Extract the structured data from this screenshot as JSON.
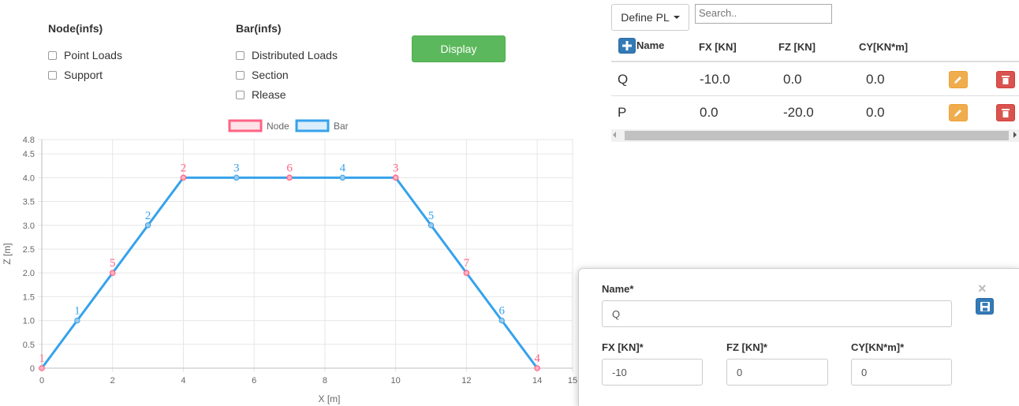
{
  "filters": {
    "node": {
      "title": "Node(infs)",
      "options": [
        {
          "label": "Point Loads",
          "checked": false
        },
        {
          "label": "Support",
          "checked": false
        }
      ]
    },
    "bar": {
      "title": "Bar(infs)",
      "options": [
        {
          "label": "Distributed Loads",
          "checked": false
        },
        {
          "label": "Section",
          "checked": false
        },
        {
          "label": "Rlease",
          "checked": false
        }
      ]
    },
    "display_label": "Display"
  },
  "chart_data": {
    "type": "line",
    "legend": [
      {
        "name": "Node",
        "color": "#ff6384"
      },
      {
        "name": "Bar",
        "color": "#36a2eb"
      }
    ],
    "xlabel": "X [m]",
    "ylabel": "Z [m]",
    "xlim": [
      0,
      15
    ],
    "ylim": [
      0,
      4.8
    ],
    "x_ticks": [
      "0",
      "2",
      "4",
      "6",
      "8",
      "10",
      "12",
      "14",
      "15"
    ],
    "y_ticks": [
      "0",
      "0.5",
      "1.0",
      "1.5",
      "2.0",
      "2.5",
      "3.0",
      "3.5",
      "4.0",
      "4.5",
      "4.8"
    ],
    "grid": true,
    "structure": [
      {
        "x": 0,
        "y": 0
      },
      {
        "x": 4,
        "y": 4
      },
      {
        "x": 10,
        "y": 4
      },
      {
        "x": 14,
        "y": 0
      }
    ],
    "nodes": [
      {
        "label": "1",
        "x": 0,
        "y": 0
      },
      {
        "label": "5",
        "x": 2,
        "y": 2
      },
      {
        "label": "2",
        "x": 4,
        "y": 4
      },
      {
        "label": "6",
        "x": 7,
        "y": 4
      },
      {
        "label": "3",
        "x": 10,
        "y": 4
      },
      {
        "label": "7",
        "x": 12,
        "y": 2
      },
      {
        "label": "4",
        "x": 14,
        "y": 0
      }
    ],
    "bars": [
      {
        "label": "1",
        "x": 1,
        "y": 1
      },
      {
        "label": "2",
        "x": 3,
        "y": 3
      },
      {
        "label": "3",
        "x": 5.5,
        "y": 4
      },
      {
        "label": "4",
        "x": 8.5,
        "y": 4
      },
      {
        "label": "5",
        "x": 11,
        "y": 3
      },
      {
        "label": "6",
        "x": 13,
        "y": 1
      }
    ]
  },
  "table": {
    "define_label": "Define PL",
    "search_placeholder": "Search..",
    "columns": [
      "Name",
      "FX [KN]",
      "FZ [KN]",
      "CY[KN*m]"
    ],
    "rows": [
      [
        "Q",
        "-10.0",
        "0.0",
        "0.0"
      ],
      [
        "P",
        "0.0",
        "-20.0",
        "0.0"
      ]
    ]
  },
  "form": {
    "name_label": "Name*",
    "name_value": "Q",
    "fx_label": "FX [KN]*",
    "fx_value": "-10",
    "fz_label": "FZ [KN]*",
    "fz_value": "0",
    "cy_label": "CY[KN*m]*",
    "cy_value": "0",
    "close_glyph": "×"
  }
}
